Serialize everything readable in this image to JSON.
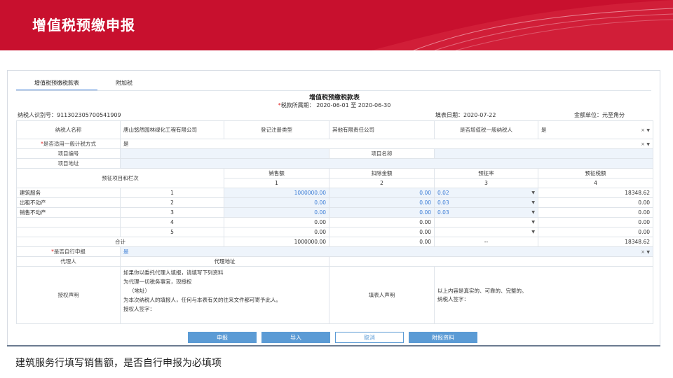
{
  "header": {
    "title": "增值税预缴申报"
  },
  "tabs": [
    {
      "label": "增值税预缴税款表"
    },
    {
      "label": "附加税"
    }
  ],
  "form": {
    "title": "增值税预缴税款表",
    "period_label": "税款所属期：",
    "period_value": "2020-06-01 至 2020-06-30",
    "taxpayer_id": "纳税人识别号：911302305700541909",
    "fill_date": "填表日期：2020-07-22",
    "unit": "金额单位：元至角分"
  },
  "info": {
    "name_label": "纳税人名称",
    "name_value": "唐山悠然园林绿化工程有限公司",
    "reg_type_label": "登记注册类型",
    "reg_type_value": "其他有限责任公司",
    "general_label": "是否增值税一般纳税人",
    "general_value": "是",
    "method_label": "是否适用一般计税方式",
    "method_value": "是",
    "proj_no_label": "项目编号",
    "proj_name_label": "项目名称",
    "proj_addr_label": "项目地址"
  },
  "table": {
    "row_header": "预征项目和栏次",
    "columns": [
      {
        "label": "销售额",
        "index": "1"
      },
      {
        "label": "扣除金额",
        "index": "2"
      },
      {
        "label": "预征率",
        "index": "3"
      },
      {
        "label": "预征税额",
        "index": "4"
      }
    ],
    "rows": [
      {
        "item": "建筑服务",
        "no": "1",
        "sales": "1000000.00",
        "deduct": "0.00",
        "rate": "0.02",
        "tax": "18348.62"
      },
      {
        "item": "出租不动产",
        "no": "2",
        "sales": "0.00",
        "deduct": "0.00",
        "rate": "0.03",
        "tax": "0.00"
      },
      {
        "item": "销售不动产",
        "no": "3",
        "sales": "0.00",
        "deduct": "0.00",
        "rate": "0.03",
        "tax": "0.00"
      },
      {
        "item": "",
        "no": "4",
        "sales": "0.00",
        "deduct": "0.00",
        "rate": "",
        "tax": "0.00"
      },
      {
        "item": "",
        "no": "5",
        "sales": "0.00",
        "deduct": "0.00",
        "rate": "",
        "tax": "0.00"
      }
    ],
    "total": {
      "label": "合计",
      "sales": "1000000.00",
      "deduct": "0.00",
      "rate": "--",
      "tax": "18348.62"
    }
  },
  "self_declare": {
    "label": "是否自行申报",
    "value": "是"
  },
  "agent": {
    "label": "代理人",
    "addr_label": "代理地址"
  },
  "auth": {
    "label": "授权声明",
    "line1": "如果你以委托代理人填报，请填写下列资料",
    "line2": "为代理一切税务事宜，现授权",
    "line3": "（地址）",
    "line4": "为本次纳税人的填报人，任何与本表有关的往来文件都可寄予此人。",
    "line5": "授权人签字：",
    "filer_label": "填表人声明",
    "filer_line1": "以上内容是真实的、可靠的、完整的。",
    "filer_line2": "纳税人签字："
  },
  "buttons": {
    "submit": "申报",
    "import": "导入",
    "cancel": "取消",
    "attach": "附报资料"
  },
  "caption": "建筑服务行填写销售额，是否自行申报为必填项",
  "colors": {
    "banner": "#c8102e",
    "accent": "#5b9bd5",
    "link_blue": "#3a7bd5",
    "input_bg": "#eef4fb"
  }
}
